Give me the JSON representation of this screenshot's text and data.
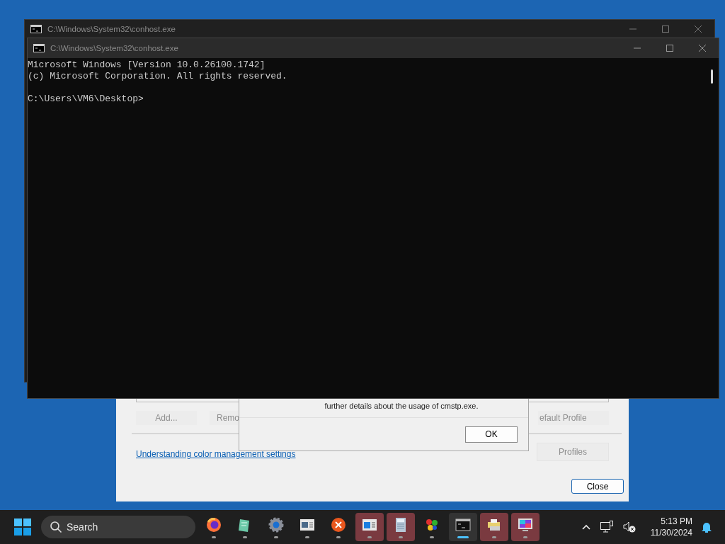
{
  "back_console": {
    "title": "C:\\Windows\\System32\\conhost.exe"
  },
  "console": {
    "title": "C:\\Windows\\System32\\conhost.exe",
    "lines": [
      "Microsoft Windows [Version 10.0.26100.1742]",
      "(c) Microsoft Corporation. All rights reserved."
    ],
    "prompt": "C:\\Users\\VM6\\Desktop>"
  },
  "color_dialog": {
    "buttons": [
      {
        "label": "Add...",
        "disabled": true
      },
      {
        "label": "Remo",
        "disabled": true
      },
      {
        "label": "efault Profile",
        "disabled": true
      }
    ],
    "link": "Understanding color management settings",
    "profiles_button": {
      "label": "Profiles",
      "disabled": true
    },
    "close_button": {
      "label": "Close"
    }
  },
  "message_box": {
    "text": "further details about the usage of cmstp.exe.",
    "button": "OK"
  },
  "taskbar": {
    "search": {
      "placeholder": "Search"
    },
    "apps": [
      {
        "kind": "firefox",
        "active": false,
        "attention": false
      },
      {
        "kind": "notepad",
        "active": false,
        "attention": false
      },
      {
        "kind": "gear",
        "active": false,
        "attention": false
      },
      {
        "kind": "window",
        "active": false,
        "attention": false
      },
      {
        "kind": "orange-x",
        "active": false,
        "attention": false
      },
      {
        "kind": "blue-window",
        "active": false,
        "attention": true
      },
      {
        "kind": "calculator",
        "active": false,
        "attention": true
      },
      {
        "kind": "colorful",
        "active": false,
        "attention": false
      },
      {
        "kind": "terminal",
        "active": true,
        "attention": false
      },
      {
        "kind": "printer",
        "active": false,
        "attention": true
      },
      {
        "kind": "monitor",
        "active": false,
        "attention": true
      }
    ],
    "clock": {
      "time": "5:13 PM",
      "date": "11/30/2024"
    }
  }
}
